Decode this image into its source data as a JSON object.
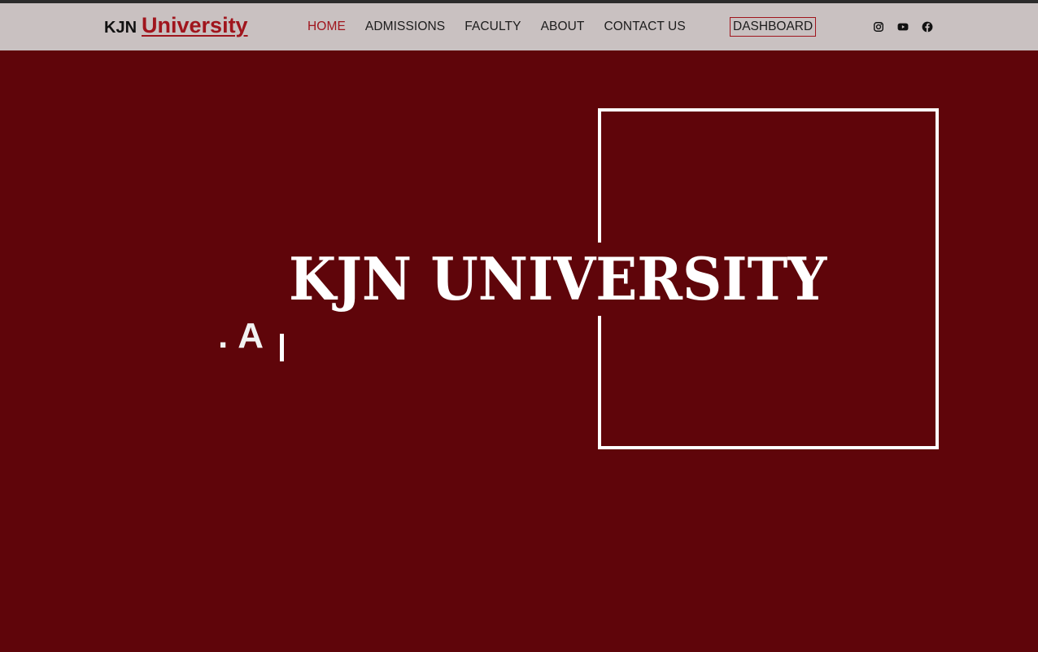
{
  "brand": {
    "prefix": "KJN",
    "name": "University"
  },
  "nav": {
    "items": [
      {
        "label": "HOME",
        "active": true
      },
      {
        "label": "ADMISSIONS",
        "active": false
      },
      {
        "label": "FACULTY",
        "active": false
      },
      {
        "label": "ABOUT",
        "active": false
      },
      {
        "label": "CONTACT US",
        "active": false
      }
    ],
    "dashboard_label": "DASHBOARD"
  },
  "social": {
    "icons": [
      "instagram-icon",
      "youtube-icon",
      "facebook-icon"
    ]
  },
  "hero": {
    "title": "KJN UNIVERSITY",
    "typed_prefix": ".",
    "typed_text": "A"
  },
  "colors": {
    "accent": "#a0151d",
    "hero_background": "#5f050a",
    "navbar_background": "#c9c1c1",
    "text_light": "#ffffff"
  }
}
